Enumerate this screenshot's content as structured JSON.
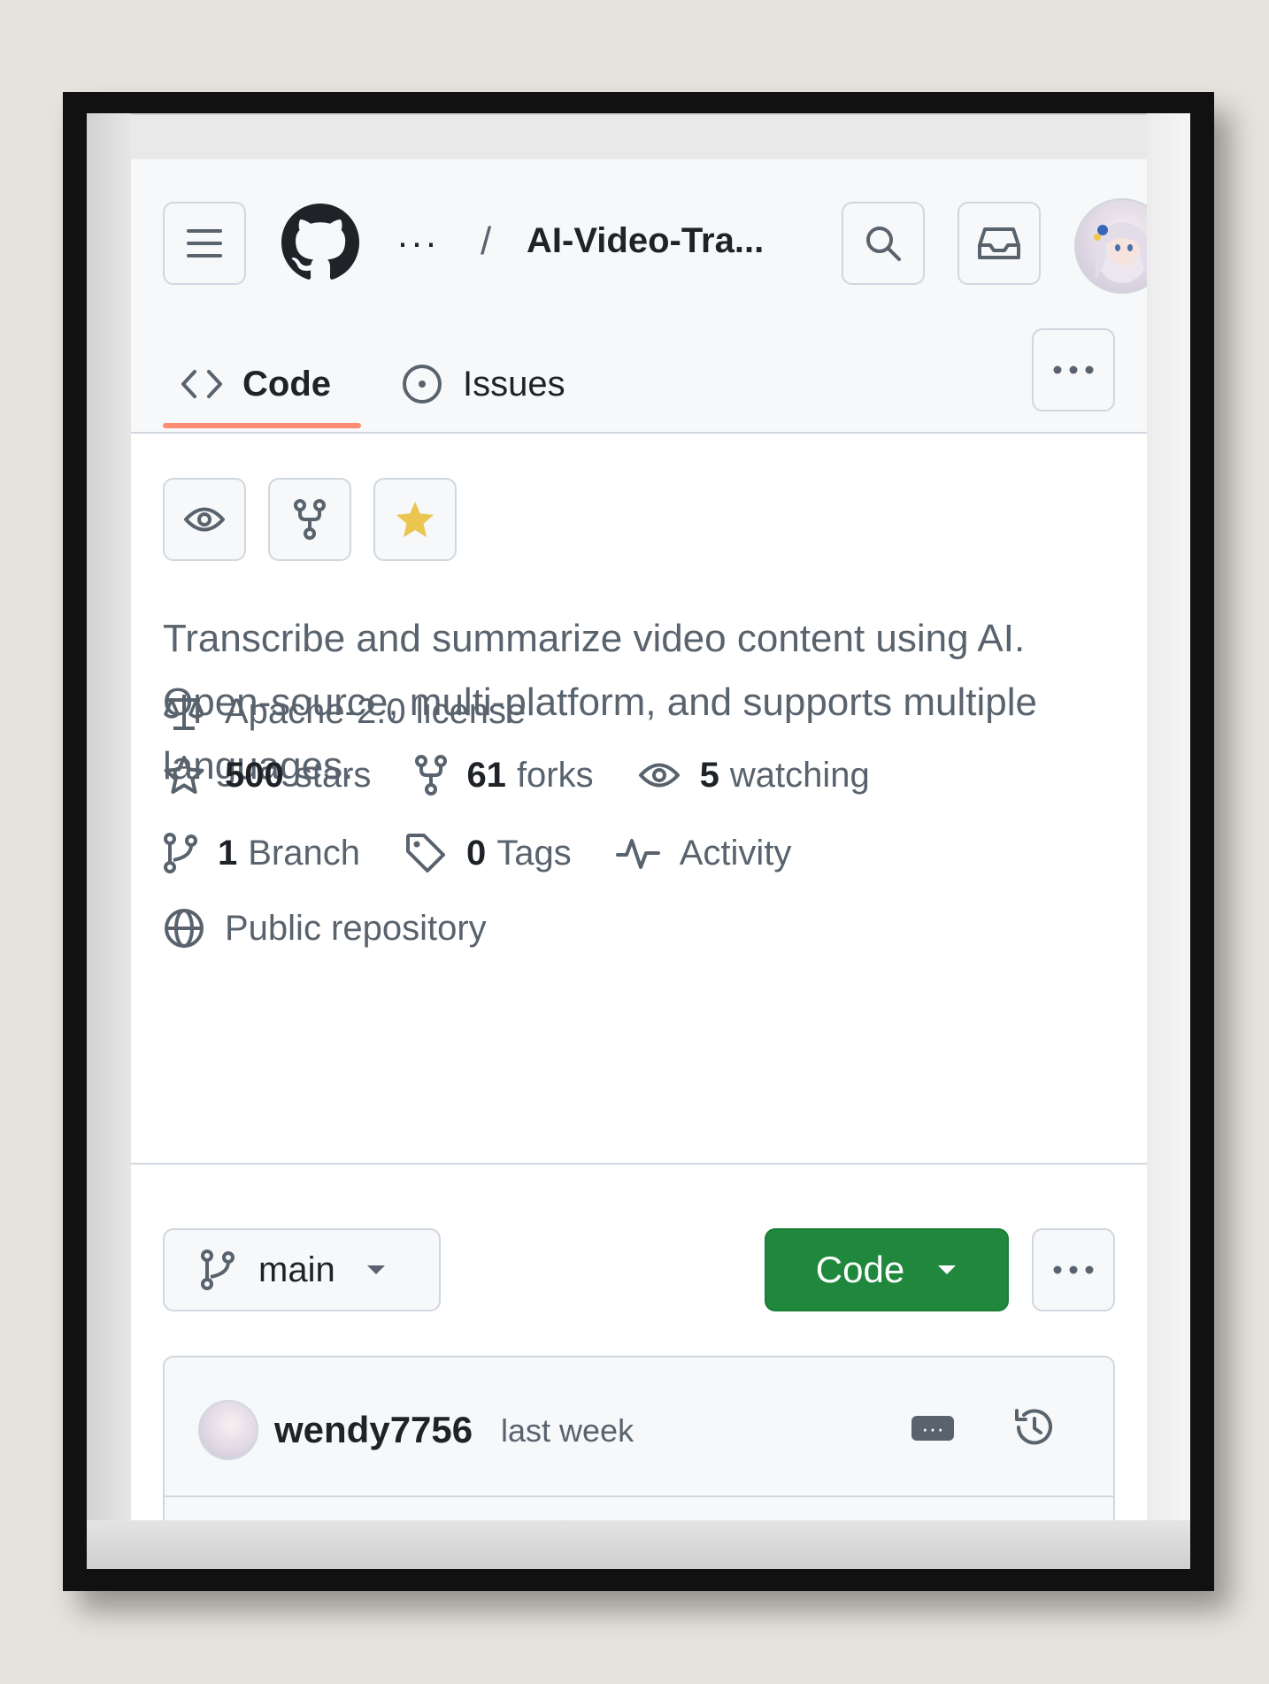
{
  "header": {
    "breadcrumb_ellipsis": "···",
    "separator": "/",
    "repo_name": "AI-Video-Tra..."
  },
  "tabs": [
    {
      "label": "Code",
      "active": true
    },
    {
      "label": "Issues",
      "active": false
    }
  ],
  "description": "Transcribe and summarize video content using AI. Open-source, multi-platform, and supports multiple languages.",
  "meta": {
    "license": "Apache-2.0 license",
    "stars_count": "500",
    "stars_label": "stars",
    "forks_count": "61",
    "forks_label": "forks",
    "watching_count": "5",
    "watching_label": "watching",
    "branch_count": "1",
    "branch_label": "Branch",
    "tags_count": "0",
    "tags_label": "Tags",
    "activity_label": "Activity",
    "visibility": "Public repository"
  },
  "toolbar": {
    "branch": "main",
    "code_button": "Code"
  },
  "commit": {
    "user": "wendy7756",
    "time": "last week",
    "msg_button": "···"
  },
  "colors": {
    "accent_underline": "#fd8c73",
    "code_button": "#1f883d",
    "star": "#eac54f"
  }
}
